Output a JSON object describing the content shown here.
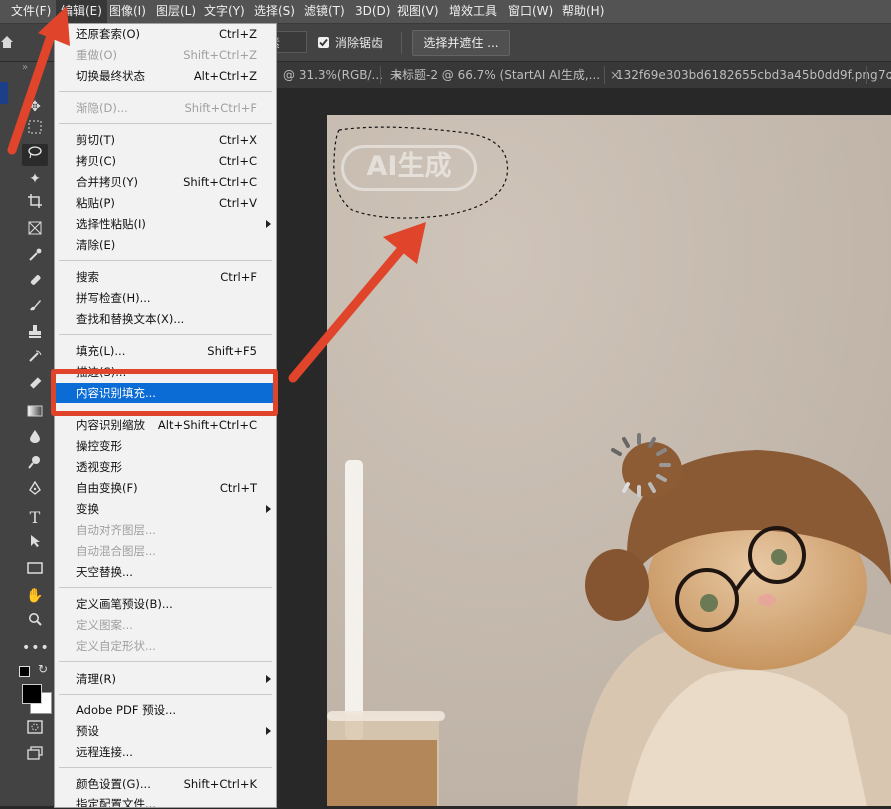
{
  "menubar": {
    "items": [
      {
        "label": "文件(F)"
      },
      {
        "label": "编辑(E)"
      },
      {
        "label": "图像(I)"
      },
      {
        "label": "图层(L)"
      },
      {
        "label": "文字(Y)"
      },
      {
        "label": "选择(S)"
      },
      {
        "label": "滤镜(T)"
      },
      {
        "label": "3D(D)"
      },
      {
        "label": "视图(V)"
      },
      {
        "label": "增效工具"
      },
      {
        "label": "窗口(W)"
      },
      {
        "label": "帮助(H)"
      }
    ]
  },
  "options": {
    "partial_label": "素",
    "antialias_label": "消除锯齿",
    "select_mask_label": "选择并遮住 ..."
  },
  "tabs": [
    {
      "label": "@ 31.3%(RGB/..."
    },
    {
      "label": "未标题-2 @ 66.7% (StartAI AI生成,..."
    },
    {
      "label": "132f69e303bd6182655cbd3a45b0dd9f.png"
    },
    {
      "label": "7c"
    }
  ],
  "edit_menu": {
    "items": [
      {
        "label": "还原套索(O)",
        "shortcut": "Ctrl+Z"
      },
      {
        "label": "重做(O)",
        "shortcut": "Shift+Ctrl+Z",
        "disabled": true
      },
      {
        "label": "切换最终状态",
        "shortcut": "Alt+Ctrl+Z"
      },
      {
        "label": "渐隐(D)...",
        "shortcut": "Shift+Ctrl+F",
        "disabled": true
      },
      {
        "label": "剪切(T)",
        "shortcut": "Ctrl+X"
      },
      {
        "label": "拷贝(C)",
        "shortcut": "Ctrl+C"
      },
      {
        "label": "合并拷贝(Y)",
        "shortcut": "Shift+Ctrl+C"
      },
      {
        "label": "粘贴(P)",
        "shortcut": "Ctrl+V"
      },
      {
        "label": "选择性粘贴(I)",
        "shortcut": ""
      },
      {
        "label": "清除(E)",
        "shortcut": ""
      },
      {
        "label": "搜索",
        "shortcut": "Ctrl+F"
      },
      {
        "label": "拼写检查(H)...",
        "shortcut": ""
      },
      {
        "label": "查找和替换文本(X)...",
        "shortcut": ""
      },
      {
        "label": "填充(L)...",
        "shortcut": "Shift+F5"
      },
      {
        "label": "描边(S)...",
        "shortcut": ""
      },
      {
        "label": "内容识别填充...",
        "shortcut": ""
      },
      {
        "label": "内容识别缩放",
        "shortcut": "Alt+Shift+Ctrl+C"
      },
      {
        "label": "操控变形",
        "shortcut": ""
      },
      {
        "label": "透视变形",
        "shortcut": ""
      },
      {
        "label": "自由变换(F)",
        "shortcut": "Ctrl+T"
      },
      {
        "label": "变换",
        "shortcut": ""
      },
      {
        "label": "自动对齐图层...",
        "shortcut": "",
        "disabled": true
      },
      {
        "label": "自动混合图层...",
        "shortcut": "",
        "disabled": true
      },
      {
        "label": "天空替换...",
        "shortcut": ""
      },
      {
        "label": "定义画笔预设(B)...",
        "shortcut": ""
      },
      {
        "label": "定义图案...",
        "shortcut": "",
        "disabled": true
      },
      {
        "label": "定义自定形状...",
        "shortcut": "",
        "disabled": true
      },
      {
        "label": "清理(R)",
        "shortcut": ""
      },
      {
        "label": "Adobe PDF 预设...",
        "shortcut": ""
      },
      {
        "label": "预设",
        "shortcut": ""
      },
      {
        "label": "远程连接...",
        "shortcut": ""
      },
      {
        "label": "颜色设置(G)...",
        "shortcut": "Shift+Ctrl+K"
      },
      {
        "label": "指定配置文件...",
        "shortcut": ""
      }
    ],
    "highlighted": "内容识别填充..."
  },
  "canvas": {
    "watermark_text": "AI生成"
  },
  "colors": {
    "menubar": "#535353",
    "menu_highlight": "#0b6cd6",
    "annotation_red": "#e0452c"
  }
}
